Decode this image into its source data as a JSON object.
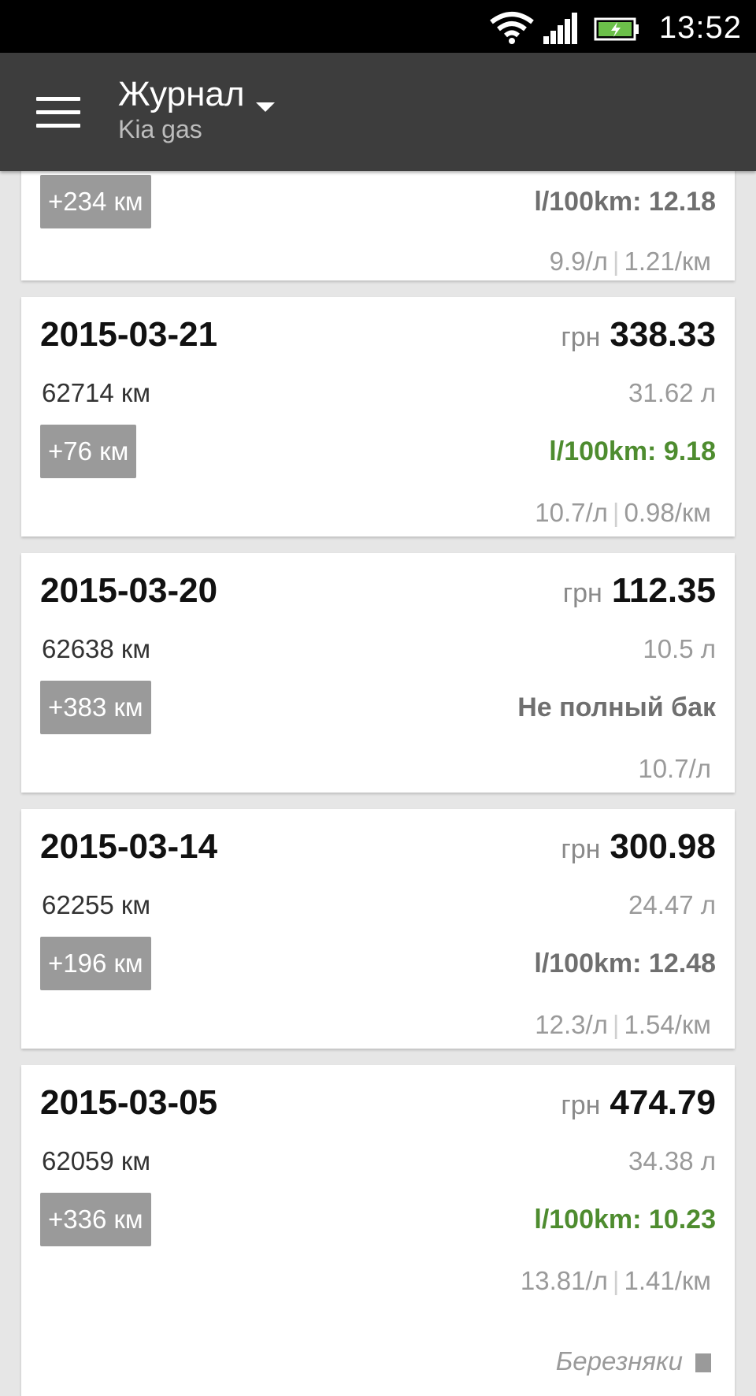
{
  "status": {
    "time": "13:52"
  },
  "header": {
    "title": "Журнал",
    "subtitle": "Kia gas"
  },
  "entries": [
    {
      "date": "",
      "currency": "",
      "amount": "",
      "odometer": "",
      "volume": "",
      "distance": "+234 км",
      "consumption": "l/100km: 12.18",
      "consumption_color": "#6f6f6f",
      "unit_price": "9.9/л",
      "per_km": "1.21/км"
    },
    {
      "date": "2015-03-21",
      "currency": "грн",
      "amount": "338.33",
      "odometer": "62714 км",
      "volume": "31.62 л",
      "distance": "+76 км",
      "consumption": "l/100km: 9.18",
      "consumption_color": "#4e8c2f",
      "unit_price": "10.7/л",
      "per_km": "0.98/км"
    },
    {
      "date": "2015-03-20",
      "currency": "грн",
      "amount": "112.35",
      "odometer": "62638 км",
      "volume": "10.5 л",
      "distance": "+383 км",
      "consumption": "Не полный бак",
      "consumption_color": "#6f6f6f",
      "unit_price": "10.7/л",
      "per_km": ""
    },
    {
      "date": "2015-03-14",
      "currency": "грн",
      "amount": "300.98",
      "odometer": "62255 км",
      "volume": "24.47 л",
      "distance": "+196 км",
      "consumption": "l/100km: 12.48",
      "consumption_color": "#6f6f6f",
      "unit_price": "12.3/л",
      "per_km": "1.54/км"
    },
    {
      "date": "2015-03-05",
      "currency": "грн",
      "amount": "474.79",
      "odometer": "62059 км",
      "volume": "34.38 л",
      "distance": "+336 км",
      "consumption": "l/100km: 10.23",
      "consumption_color": "#4e8c2f",
      "unit_price": "13.81/л",
      "per_km": "1.41/км",
      "station": "Березняки"
    }
  ]
}
